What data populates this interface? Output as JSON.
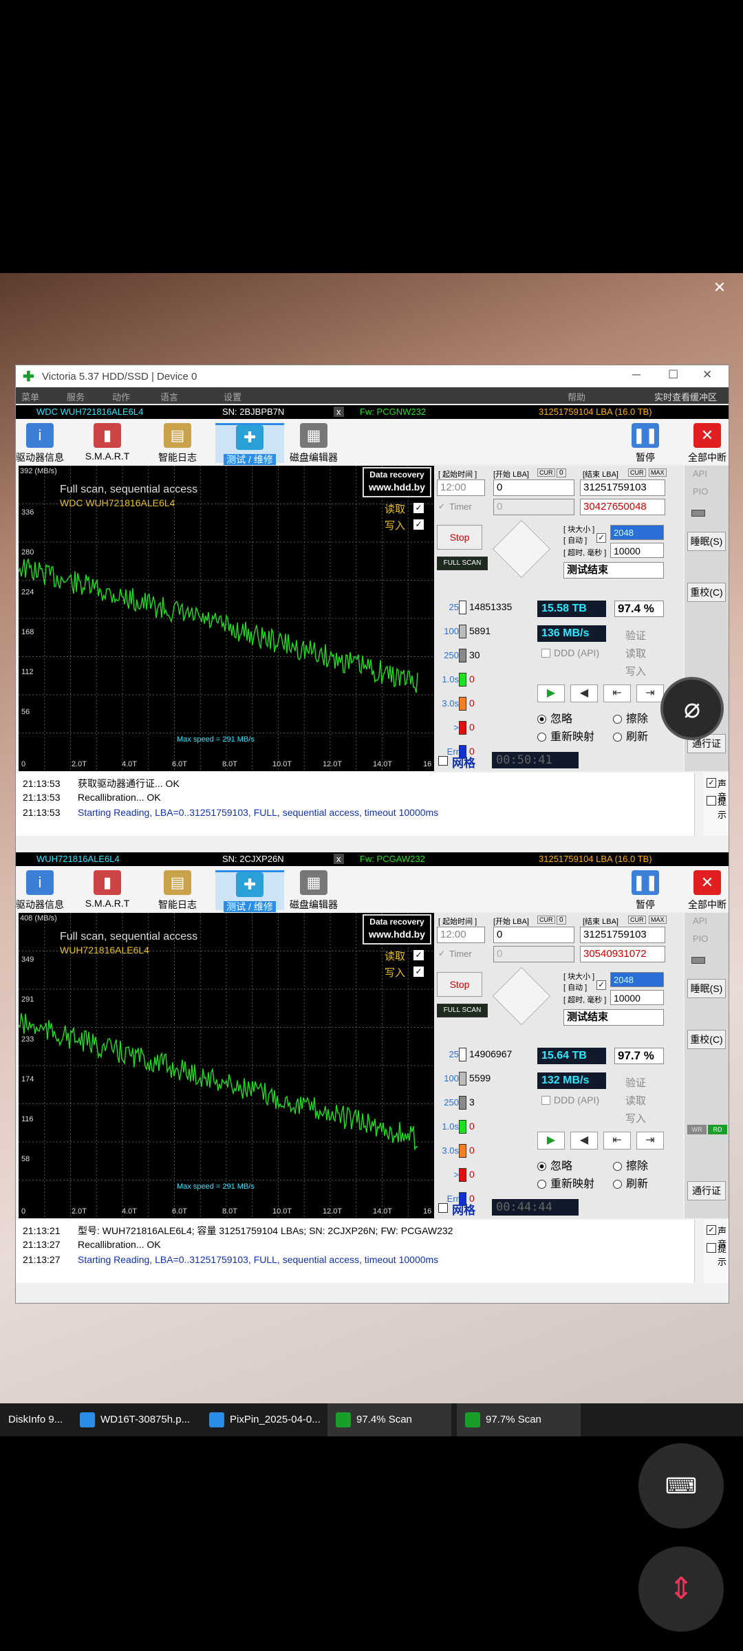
{
  "window": {
    "title": "Victoria 5.37 HDD/SSD | Device 0",
    "menu": [
      "菜单",
      "服务",
      "动作",
      "语言",
      "设置"
    ],
    "help": "帮助",
    "cache_label": "实时查看缓冲区"
  },
  "panels": [
    {
      "drive": {
        "model": "WDC  WUH721816ALE6L4",
        "sn": "SN: 2BJBPB7N",
        "fw": "Fw: PCGNW232",
        "lba": "31251759104 LBA (16.0 TB)"
      },
      "toolbar": {
        "info": "驱动器信息",
        "smart": "S.M.A.R.T",
        "log": "智能日志",
        "test": "测试 / 维修",
        "editor": "磁盘编辑器",
        "pause": "暂停",
        "abort": "全部中断"
      },
      "graph": {
        "unit": "392 (MB/s)",
        "scan_title": "Full scan, sequential access",
        "model": "WDC  WUH721816ALE6L4",
        "read_label": "读取",
        "write_label": "写入",
        "max_speed": "Max speed = 291 MB/s",
        "recovery1": "Data recovery",
        "recovery2": "www.hdd.by"
      },
      "controls": {
        "time_label": "[ 起始时间 ]",
        "start_lba_label": "[开始 LBA]",
        "cur": "CUR",
        "zero": "0",
        "end_lba_label": "[结束 LBA]",
        "max": "MAX",
        "time": "12:00",
        "start_lba": "0",
        "end_lba": "31251759103",
        "timer_label": "Timer",
        "timer_val": "0",
        "cur_lba": "30427650048",
        "stop": "Stop",
        "full_scan": "FULL SCAN",
        "block_label": "[ 块大小 ]",
        "auto_label": "[ 自动 ]",
        "timeout_label": "[ 超时, 毫秒 ]",
        "block_val": "2048",
        "timeout_val": "10000",
        "mode": "测试结束"
      },
      "counts": {
        "c25": "14851335",
        "c100": "5891",
        "c250": "30",
        "c1s": "0",
        "c3s": "0",
        "cgt": "0",
        "cerr": "0",
        "l25": "25",
        "l100": "100",
        "l250": "250",
        "l1s": "1.0s",
        "l3s": "3.0s",
        "lgt": ">",
        "lerr": "Err"
      },
      "stats": {
        "size": "15.58 TB",
        "pct": "97.4  %",
        "speed": "136 MB/s",
        "verify": "验证",
        "read": "读取",
        "write": "写入",
        "ddd": "DDD (API)"
      },
      "options": {
        "ignore": "忽略",
        "erase": "擦除",
        "remap": "重新映射",
        "refresh": "刷新",
        "grid": "网格",
        "elapsed": "00:50:41"
      },
      "right": {
        "api": "API",
        "pio": "PIO",
        "sleep": "睡眠(S)",
        "recal": "重校(C)",
        "passport": "通行证",
        "sound": "声音",
        "hints": "提示"
      },
      "log": [
        {
          "t": "21:13:53",
          "msg": "获取驱动器通行证... OK",
          "color": "#000"
        },
        {
          "t": "21:13:53",
          "msg": "Recallibration... OK",
          "color": "#000"
        },
        {
          "t": "21:13:53",
          "msg": "Starting Reading, LBA=0..31251759103, FULL, sequential access, timeout 10000ms",
          "color": "#1030b0"
        }
      ],
      "ticks_y": [
        "336",
        "280",
        "224",
        "168",
        "112",
        "56"
      ],
      "ticks_x": [
        "0",
        "2.0T",
        "4.0T",
        "6.0T",
        "8.0T",
        "10.0T",
        "12.0T",
        "14.0T",
        "16"
      ]
    },
    {
      "drive": {
        "model": "WUH721816ALE6L4",
        "sn": "SN: 2CJXP26N",
        "fw": "Fw: PCGAW232",
        "lba": "31251759104 LBA (16.0 TB)"
      },
      "toolbar": {
        "info": "驱动器信息",
        "smart": "S.M.A.R.T",
        "log": "智能日志",
        "test": "测试 / 维修",
        "editor": "磁盘编辑器",
        "pause": "暂停",
        "abort": "全部中断"
      },
      "graph": {
        "unit": "408 (MB/s)",
        "scan_title": "Full scan, sequential access",
        "model": "WUH721816ALE6L4",
        "read_label": "读取",
        "write_label": "写入",
        "max_speed": "Max speed = 291 MB/s",
        "recovery1": "Data recovery",
        "recovery2": "www.hdd.by"
      },
      "controls": {
        "time_label": "[ 起始时间 ]",
        "start_lba_label": "[开始 LBA]",
        "cur": "CUR",
        "zero": "0",
        "end_lba_label": "[结束 LBA]",
        "max": "MAX",
        "time": "12:00",
        "start_lba": "0",
        "end_lba": "31251759103",
        "timer_label": "Timer",
        "timer_val": "0",
        "cur_lba": "30540931072",
        "stop": "Stop",
        "full_scan": "FULL SCAN",
        "block_label": "[ 块大小 ]",
        "auto_label": "[ 自动 ]",
        "timeout_label": "[ 超时, 毫秒 ]",
        "block_val": "2048",
        "timeout_val": "10000",
        "mode": "测试结束"
      },
      "counts": {
        "c25": "14906967",
        "c100": "5599",
        "c250": "3",
        "c1s": "0",
        "c3s": "0",
        "cgt": "0",
        "cerr": "0",
        "l25": "25",
        "l100": "100",
        "l250": "250",
        "l1s": "1.0s",
        "l3s": "3.0s",
        "lgt": ">",
        "lerr": "Err"
      },
      "stats": {
        "size": "15.64 TB",
        "pct": "97.7  %",
        "speed": "132 MB/s",
        "verify": "验证",
        "read": "读取",
        "write": "写入",
        "ddd": "DDD (API)"
      },
      "options": {
        "ignore": "忽略",
        "erase": "擦除",
        "remap": "重新映射",
        "refresh": "刷新",
        "grid": "网格",
        "elapsed": "00:44:44"
      },
      "right": {
        "api": "API",
        "pio": "PIO",
        "sleep": "睡眠(S)",
        "recal": "重校(C)",
        "passport": "通行证",
        "sound": "声音",
        "hints": "提示",
        "wr": "WR",
        "rd": "RD"
      },
      "log": [
        {
          "t": "21:13:21",
          "msg": "型号: WUH721816ALE6L4; 容量 31251759104 LBAs; SN: 2CJXP26N; FW: PCGAW232",
          "color": "#000"
        },
        {
          "t": "21:13:27",
          "msg": "Recallibration... OK",
          "color": "#000"
        },
        {
          "t": "21:13:27",
          "msg": "Starting Reading, LBA=0..31251759103, FULL, sequential access, timeout 10000ms",
          "color": "#1030b0"
        }
      ],
      "ticks_y": [
        "349",
        "291",
        "233",
        "174",
        "116",
        "58"
      ],
      "ticks_x": [
        "0",
        "2.0T",
        "4.0T",
        "6.0T",
        "8.0T",
        "10.0T",
        "12.0T",
        "14.0T",
        "16"
      ]
    }
  ],
  "taskbar": [
    {
      "label": "DiskInfo 9...",
      "color": "#3a6fd8"
    },
    {
      "label": "WD16T-30875h.p...",
      "color": "#2a8ee8"
    },
    {
      "label": "PixPin_2025-04-0...",
      "color": "#2a8ee8"
    },
    {
      "label": "97.4%  Scan",
      "color": "#1a9e2a"
    },
    {
      "label": "97.7%  Scan",
      "color": "#1a9e2a"
    }
  ],
  "colors": {
    "accent_green": "#1fe01f",
    "speed_cyan": "#2ae8ff",
    "lba_orange": "#ffb000"
  }
}
